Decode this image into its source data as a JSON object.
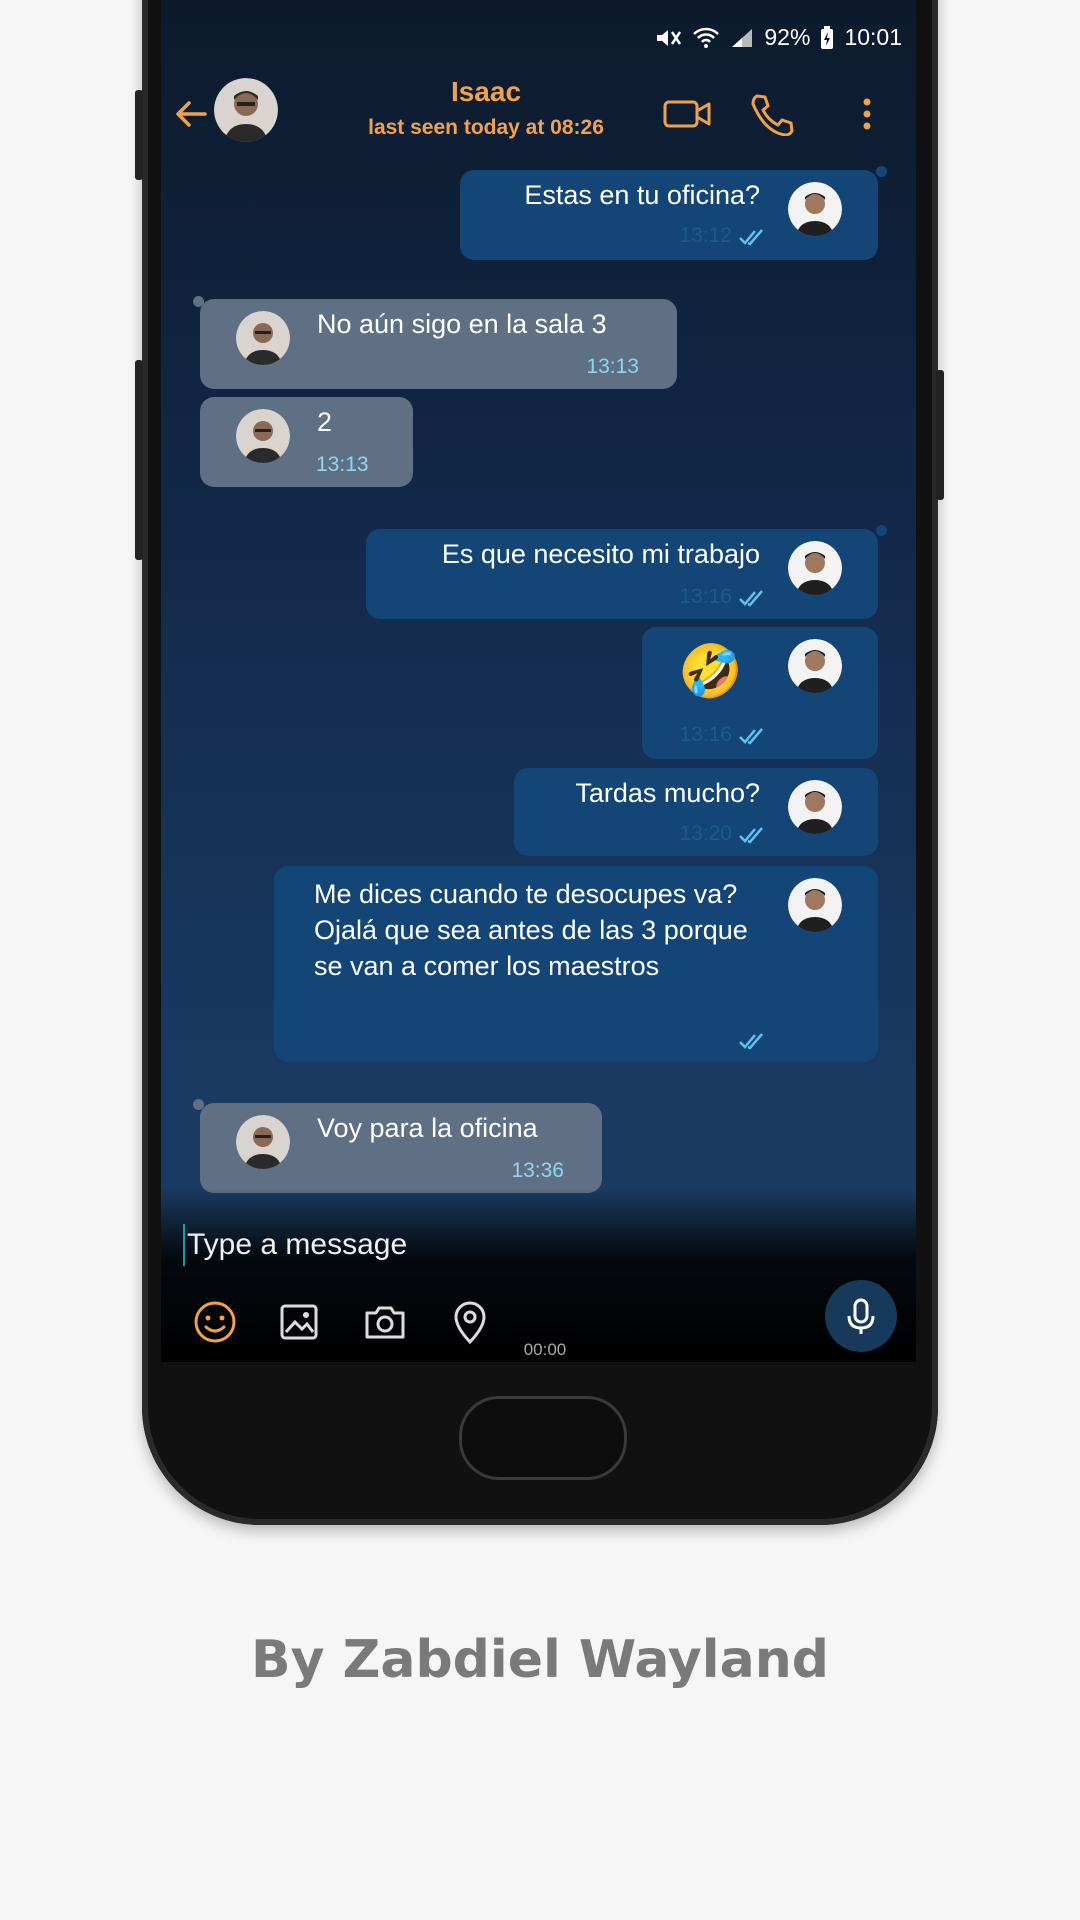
{
  "status_bar": {
    "battery": "92%",
    "time": "10:01"
  },
  "header": {
    "name": "Isaac",
    "last_seen": "last seen today at 08:26"
  },
  "messages": [
    {
      "text": "Estas en tu oficina?",
      "time": "13:12"
    },
    {
      "text": "No aún sigo en la sala 3",
      "time": "13:13"
    },
    {
      "text": "2",
      "time": "13:13"
    },
    {
      "text": "Es que necesito mi trabajo",
      "time": "13:16"
    },
    {
      "text": "🤣",
      "time": "13:16"
    },
    {
      "text": "Tardas mucho?",
      "time": "13:20"
    },
    {
      "text": "Me dices cuando te desocupes va? Ojalá que sea antes de las 3 porque se van a comer los maestros",
      "time": ""
    },
    {
      "text": "Voy para la oficina",
      "time": "13:36"
    }
  ],
  "composer": {
    "placeholder": "Type a message",
    "timer": "00:00"
  },
  "caption": "By Zabdiel Wayland",
  "colors": {
    "accent": "#f2a24a",
    "outgoing_bubble": "#134576",
    "incoming_bubble": "#5f7085",
    "time_text": "#8fd6ef"
  },
  "icons": [
    "back-arrow-icon",
    "video-call-icon",
    "phone-icon",
    "more-vert-icon",
    "double-check-icon",
    "emoji-icon",
    "gallery-icon",
    "camera-icon",
    "location-icon",
    "microphone-icon"
  ]
}
